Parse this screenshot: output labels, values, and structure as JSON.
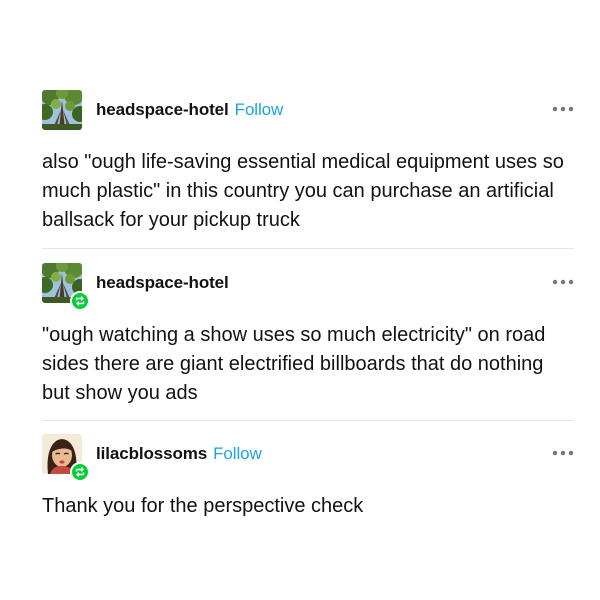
{
  "posts": [
    {
      "username": "headspace-hotel",
      "follow_label": "Follow",
      "text": "also \"ough life-saving essential medical equipment uses so much plastic\" in this country you can purchase an artificial ballsack for your pickup truck",
      "avatar": "trees-photo-avatar",
      "reblog": false
    },
    {
      "username": "headspace-hotel",
      "text": "\"ough watching a show uses so much electricity\" on road sides there are giant electrified billboards that do nothing but show you ads",
      "avatar": "trees-photo-avatar",
      "reblog": true
    },
    {
      "username": "lilacblossoms",
      "follow_label": "Follow",
      "text": "Thank you for the perspective check",
      "avatar": "illustrated-woman-avatar",
      "reblog": true
    }
  ],
  "icons": {
    "more": "ellipsis-icon",
    "reblog": "reblog-icon"
  },
  "colors": {
    "follow": "#1ba3e6",
    "reblog_badge": "#00cf35",
    "text": "#121212",
    "divider": "#e6e6e6"
  }
}
